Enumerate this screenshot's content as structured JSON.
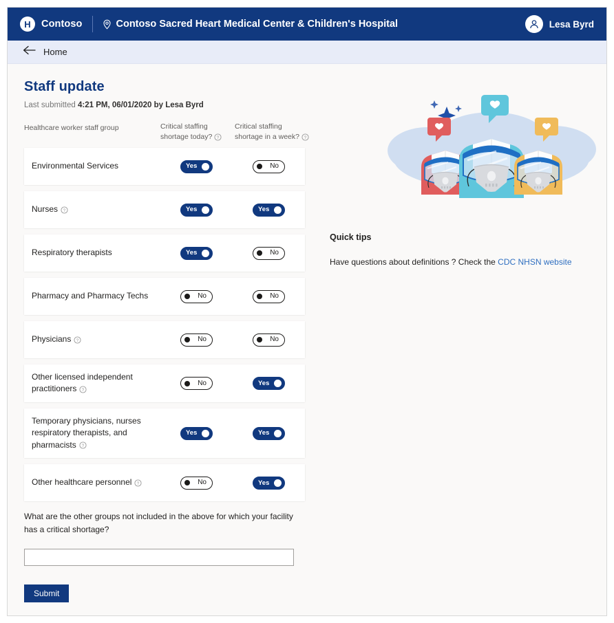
{
  "topbar": {
    "brand_initial": "H",
    "brand_name": "Contoso",
    "location_icon": "location-pin-icon",
    "site_name": "Contoso Sacred Heart Medical Center & Children's Hospital",
    "user_name": "Lesa Byrd",
    "avatar_icon": "person-icon"
  },
  "breadcrumb": {
    "back_icon": "arrow-left-icon",
    "label": "Home"
  },
  "page": {
    "title": "Staff update",
    "last_submitted_prefix": "Last submitted ",
    "last_submitted_value": "4:21 PM, 06/01/2020 by Lesa Byrd"
  },
  "table": {
    "headers": {
      "group": "Healthcare worker staff group",
      "today": "Critical staffing shortage today?",
      "week": "Critical staffing shortage in a week?",
      "info_icon": "help-circle-icon"
    },
    "toggle_labels": {
      "on": "Yes",
      "off": "No"
    },
    "rows": [
      {
        "label": "Environmental Services",
        "has_info": false,
        "today": "Yes",
        "week": "No"
      },
      {
        "label": "Nurses",
        "has_info": true,
        "today": "Yes",
        "week": "Yes"
      },
      {
        "label": "Respiratory therapists",
        "has_info": false,
        "today": "Yes",
        "week": "No"
      },
      {
        "label": "Pharmacy and Pharmacy Techs",
        "has_info": false,
        "today": "No",
        "week": "No"
      },
      {
        "label": "Physicians",
        "has_info": true,
        "today": "No",
        "week": "No"
      },
      {
        "label": "Other licensed independent practitioners",
        "has_info": true,
        "today": "No",
        "week": "Yes"
      },
      {
        "label": "Temporary physicians, nurses respiratory therapists, and pharmacists",
        "has_info": true,
        "today": "Yes",
        "week": "Yes"
      },
      {
        "label": "Other healthcare personnel",
        "has_info": true,
        "today": "No",
        "week": "Yes"
      }
    ]
  },
  "free_text": {
    "question": "What are the other groups not included in the above for which your facility has a critical shortage?",
    "value": "",
    "placeholder": ""
  },
  "submit": {
    "label": "Submit"
  },
  "quick_tips": {
    "title": "Quick tips",
    "text_before": "Have questions about definitions ? Check the ",
    "link_text": "CDC NHSN website"
  },
  "illustration": {
    "name": "healthcare-workers-masks-illustration",
    "cloud_color": "#b7cfee",
    "mask_color": "#d8dade",
    "shield_color": "#1f6fc4",
    "worker_colors": [
      "#e05d5d",
      "#5fc6dc",
      "#f0bb5a"
    ],
    "bubble_colors": [
      "#e05d5d",
      "#5fc6dc",
      "#f0bb5a"
    ],
    "sparkle_color": "#1f4fa8"
  },
  "colors": {
    "navy": "#11397f",
    "breadcrumb_bg": "#e8ecf8",
    "page_bg": "#faf9f8",
    "card_bg": "#ffffff",
    "link": "#2f6fc0",
    "muted_text": "#605e5c"
  }
}
